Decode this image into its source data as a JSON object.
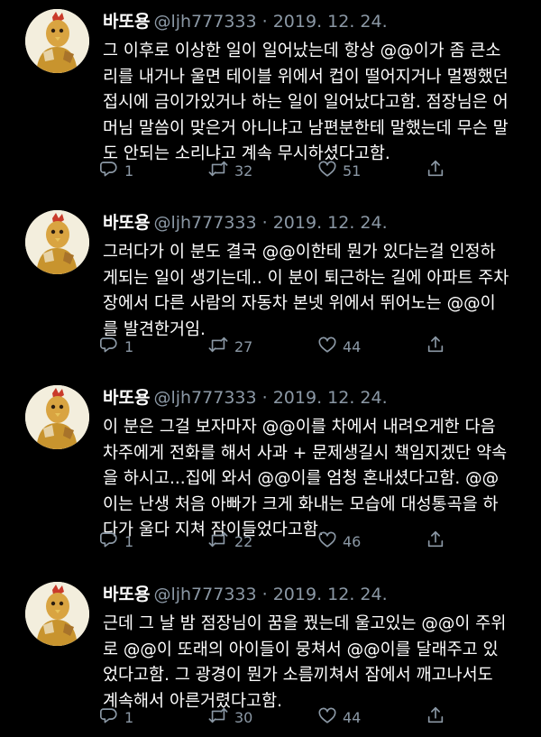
{
  "tweets": [
    {
      "display_name": "바또용",
      "handle": "@ljh777333",
      "date": "2019. 12. 24.",
      "lines": [
        "그 이후로 이상한 일이 일어났는데 항상 @@이가 좀 큰소",
        "리를 내거나 울면 테이블 위에서 컵이 떨어지거나 멀쩡했던",
        "접시에 금이가있거나 하는 일이 일어났다고함. 점장님은 어",
        "머님 말씀이 맞은거 아니냐고 남편분한테 말했는데 무슨 말",
        "도 안되는 소리냐고 계속 무시하셨다고함."
      ],
      "replies": "1",
      "retweets": "32",
      "likes": "51"
    },
    {
      "display_name": "바또용",
      "handle": "@ljh777333",
      "date": "2019. 12. 24.",
      "lines": [
        "그러다가 이 분도 결국 @@이한테 뭔가 있다는걸 인정하",
        "게되는 일이 생기는데.. 이 분이 퇴근하는 길에 아파트 주차",
        "장에서 다른 사람의 자동차 본넷 위에서 뛰어노는 @@이",
        "를 발견한거임."
      ],
      "replies": "1",
      "retweets": "27",
      "likes": "44"
    },
    {
      "display_name": "바또용",
      "handle": "@ljh777333",
      "date": "2019. 12. 24.",
      "lines": [
        "이 분은 그걸 보자마자 @@이를 차에서 내려오게한 다음",
        "차주에게 전화를 해서 사과 + 문제생길시 책임지겠단 약속",
        "을 하시고...집에 와서 @@이를 엄청 혼내셨다고함. @@",
        "이는 난생 처음 아빠가 크게 화내는 모습에 대성통곡을 하",
        "다가 울다 지쳐 잠이들었다고함."
      ],
      "replies": "1",
      "retweets": "22",
      "likes": "46"
    },
    {
      "display_name": "바또용",
      "handle": "@ljh777333",
      "date": "2019. 12. 24.",
      "lines": [
        "근데 그 날 밤 점장님이 꿈을 꿨는데 울고있는 @@이 주위",
        "로 @@이 또래의 아이들이 뭉쳐서 @@이를 달래주고 있",
        "었다고함. 그 광경이 뭔가 소름끼쳐서 잠에서 깨고나서도",
        "계속해서 아른거렸다고함."
      ],
      "replies": "1",
      "retweets": "30",
      "likes": "44"
    }
  ],
  "colors": {
    "background": "#000000",
    "text": "#ffffff",
    "secondary": "#8b98a5"
  },
  "icons": [
    "reply-icon",
    "retweet-icon",
    "like-icon",
    "share-icon"
  ]
}
